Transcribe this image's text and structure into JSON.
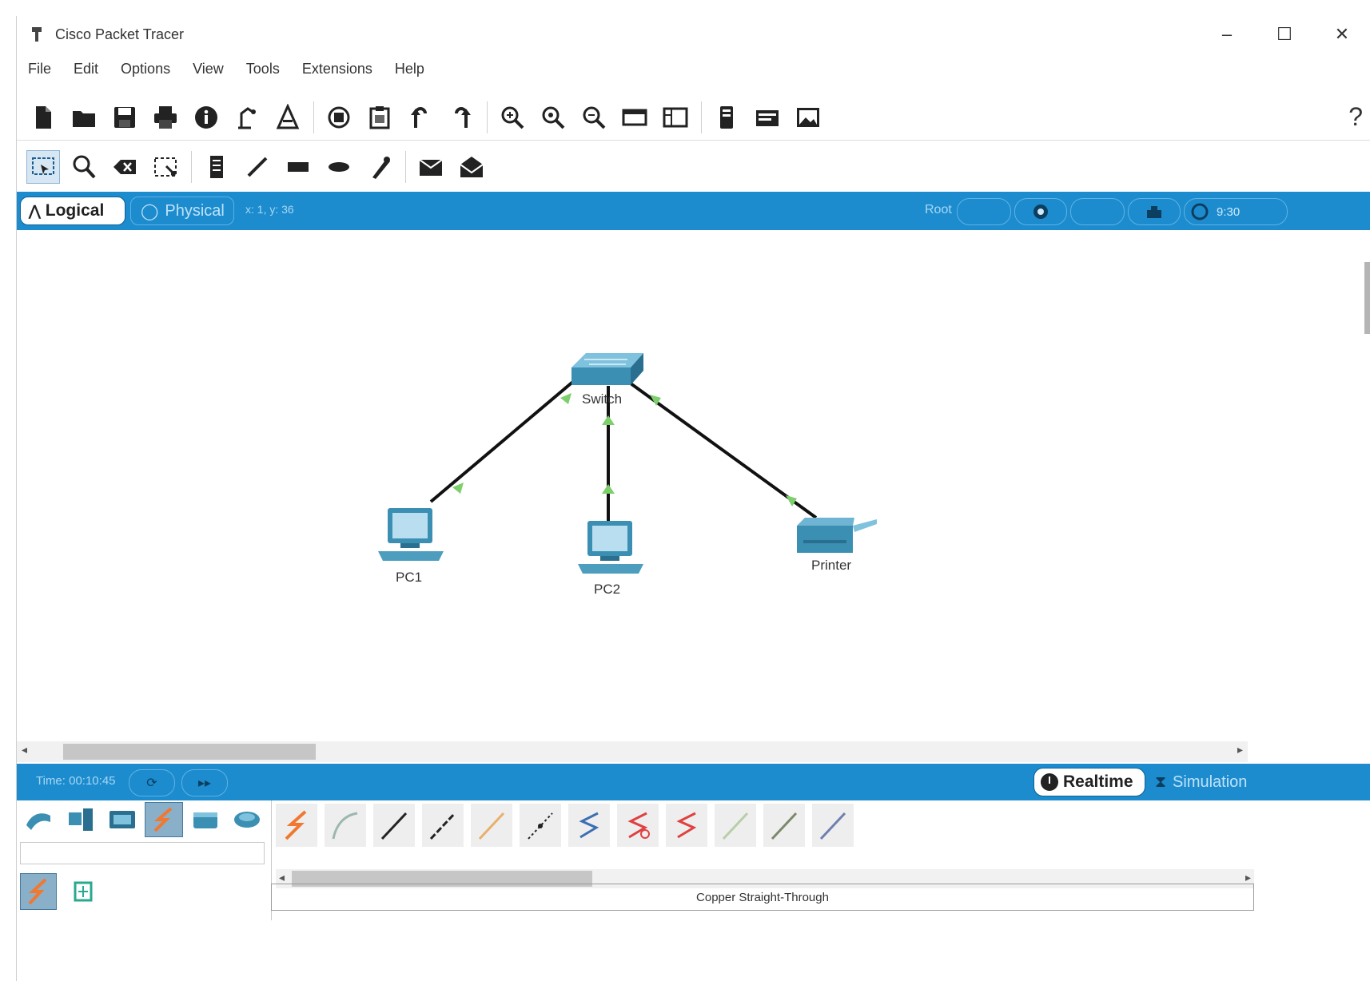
{
  "window": {
    "title": "Cisco Packet Tracer",
    "controls": {
      "minimize": "–",
      "maximize": "☐",
      "close": "✕"
    }
  },
  "menu": [
    "File",
    "Edit",
    "Options",
    "View",
    "Tools",
    "Extensions",
    "Help"
  ],
  "toolbar_main": {
    "icons": [
      "new-file-icon",
      "open-folder-icon",
      "save-icon",
      "print-icon",
      "info-icon",
      "activity-wizard-icon",
      "network-info-icon",
      "copy-icon",
      "paste-icon",
      "undo-icon",
      "redo-icon",
      "zoom-in-icon",
      "zoom-reset-icon",
      "zoom-out-icon",
      "drawing-palette-icon",
      "custom-device-icon",
      "device-icon",
      "pdu-icon",
      "image-icon"
    ],
    "help": "?"
  },
  "toolbar_tools": {
    "icons": [
      "select-icon",
      "inspect-icon",
      "delete-icon",
      "resize-icon",
      "note-icon",
      "draw-line-icon",
      "draw-rectangle-icon",
      "draw-ellipse-icon",
      "freeform-icon",
      "add-simple-pdu-icon",
      "add-complex-pdu-icon"
    ]
  },
  "workspace": {
    "tab_logical": "Logical",
    "tab_physical": "Physical",
    "coords": "x: 1, y: 36",
    "root_label": "Root",
    "right_icons": [
      "viewport-icon",
      "cluster-icon",
      "environment-icon"
    ],
    "time_short": "9:30"
  },
  "topology": {
    "devices": [
      {
        "name": "Switch",
        "type": "switch"
      },
      {
        "name": "PC1",
        "type": "pc"
      },
      {
        "name": "PC2",
        "type": "pc"
      },
      {
        "name": "Printer",
        "type": "printer"
      }
    ],
    "links": [
      {
        "from": "Switch",
        "to": "PC1",
        "status": "up"
      },
      {
        "from": "Switch",
        "to": "PC2",
        "status": "up"
      },
      {
        "from": "Switch",
        "to": "Printer",
        "status": "up"
      }
    ],
    "link_color": "#111111",
    "link_light_color": "#7ccf6a"
  },
  "bottombar": {
    "time": "Time: 00:10:45",
    "realtime": "Realtime",
    "simulation": "Simulation"
  },
  "device_panel": {
    "categories": [
      "network-devices-icon",
      "end-devices-icon",
      "components-icon",
      "connections-icon",
      "misc-icon",
      "multiuser-icon"
    ],
    "selected_category": "connections-icon",
    "subcategories": [
      "connections-subcat-icon",
      "structured-cabling-icon"
    ],
    "cables": [
      "automatic-cable-icon",
      "console-cable-icon",
      "copper-straight-through-icon",
      "copper-cross-over-icon",
      "fiber-icon",
      "phone-cable-icon",
      "coaxial-cable-icon",
      "serial-dce-icon",
      "serial-dte-icon",
      "octal-cable-icon",
      "iot-custom-cable-icon",
      "usb-cable-icon"
    ],
    "selected_cable_name": "Copper Straight-Through"
  },
  "colors": {
    "accent": "#1c8ccf",
    "device": "#3b8fb3"
  }
}
